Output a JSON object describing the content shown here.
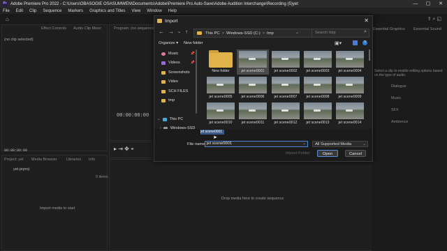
{
  "app": {
    "title": "Adobe Premiere Pro 2022 - C:\\Users\\OBASOGIE OSASUMWEN\\Documents\\Adobe\\Premiere Pro Auto-Save\\Adobe Audition Interchange\\Recording (5)yet",
    "logo_text": "Pr",
    "win_controls": [
      "—",
      "▢",
      "✕"
    ]
  },
  "menu": [
    "File",
    "Edit",
    "Clip",
    "Sequence",
    "Markers",
    "Graphics and Titles",
    "View",
    "Window",
    "Help"
  ],
  "panels": {
    "source_tab": "Effect Controls",
    "audio_mixer_tab": "Audio Clip Mixer",
    "program_tab": "Program: (no sequences)",
    "no_clip": "(no clip selected)",
    "source_tc": "00:00:00:00",
    "program_tc": "00:00:00:00",
    "project_tab": "Project: yet",
    "media_browser_tab": "Media Browser",
    "libraries_tab": "Libraries",
    "info_tab": "Info",
    "project_file": "yet.prproj",
    "item_count": "0 items",
    "import_hint": "Import media to start",
    "drop_hint": "Drop media here to create sequence",
    "right_tabs": [
      "Essential Graphics",
      "Essential Sound"
    ],
    "right_items": [
      "Dialogue",
      "Music",
      "SFX",
      "Ambience"
    ],
    "right_hint": "Select a clip to enable editing options based on the type of audio."
  },
  "dialog": {
    "title": "Import",
    "close": "✕",
    "nav": {
      "back": "←",
      "forward": "→",
      "recent": "⌄",
      "up": "↑"
    },
    "path": [
      "This PC",
      "Windows-SSD (C:)",
      "tmp"
    ],
    "path_sep": ">",
    "refresh": "↻",
    "search_placeholder": "Search tmp",
    "organize": "Organize ▾",
    "new_folder": "New folder",
    "nav_pane": [
      {
        "label": "Music",
        "icon": "music-icon",
        "color": "#e07a9e",
        "pinned": true
      },
      {
        "label": "Videos",
        "icon": "videos-icon",
        "color": "#9b6ad6",
        "pinned": true
      },
      {
        "label": "Screenshots",
        "icon": "folder-icon",
        "color": "#e0b24a",
        "pinned": false
      },
      {
        "label": "Video",
        "icon": "folder-icon",
        "color": "#e0b24a",
        "pinned": false
      },
      {
        "label": "SCH FILES",
        "icon": "folder-icon",
        "color": "#e0b24a",
        "pinned": false
      },
      {
        "label": "tmp",
        "icon": "folder-icon",
        "color": "#e0b24a",
        "pinned": false
      },
      {
        "label": "This PC",
        "icon": "computer-icon",
        "color": "#4aa8d8",
        "pinned": false
      },
      {
        "label": "Windows-SSD",
        "icon": "drive-icon",
        "color": "#999999",
        "pinned": false
      }
    ],
    "files": [
      {
        "label": "New folder",
        "type": "folder",
        "selected": false
      },
      {
        "label": "jet scene0001",
        "type": "image",
        "selected": true
      },
      {
        "label": "jet scene0002",
        "type": "image",
        "selected": false
      },
      {
        "label": "jet scene0003",
        "type": "image",
        "selected": false
      },
      {
        "label": "jet scene0004",
        "type": "image",
        "selected": false
      },
      {
        "label": "jet scene0005",
        "type": "image",
        "selected": false
      },
      {
        "label": "jet scene0006",
        "type": "image",
        "selected": false
      },
      {
        "label": "jet scene0007",
        "type": "image",
        "selected": false
      },
      {
        "label": "jet scene0008",
        "type": "image",
        "selected": false
      },
      {
        "label": "jet scene0009",
        "type": "image",
        "selected": false
      },
      {
        "label": "jet scene0010",
        "type": "image",
        "selected": false
      },
      {
        "label": "jet scene0011",
        "type": "image",
        "selected": false
      },
      {
        "label": "jet scene0012",
        "type": "image",
        "selected": false
      },
      {
        "label": "jet scene0013",
        "type": "image",
        "selected": false
      },
      {
        "label": "jet scene0014",
        "type": "image",
        "selected": false
      }
    ],
    "file_name_label": "File name:",
    "file_name_value": "jet scene0001",
    "file_type": "All Supported Media",
    "import_folder": "Import Folder",
    "open": "Open",
    "cancel": "Cancel",
    "drag_label": "jet scene0001"
  },
  "colors": {
    "accent": "#4a86d8",
    "folder": "#e0b24a"
  }
}
